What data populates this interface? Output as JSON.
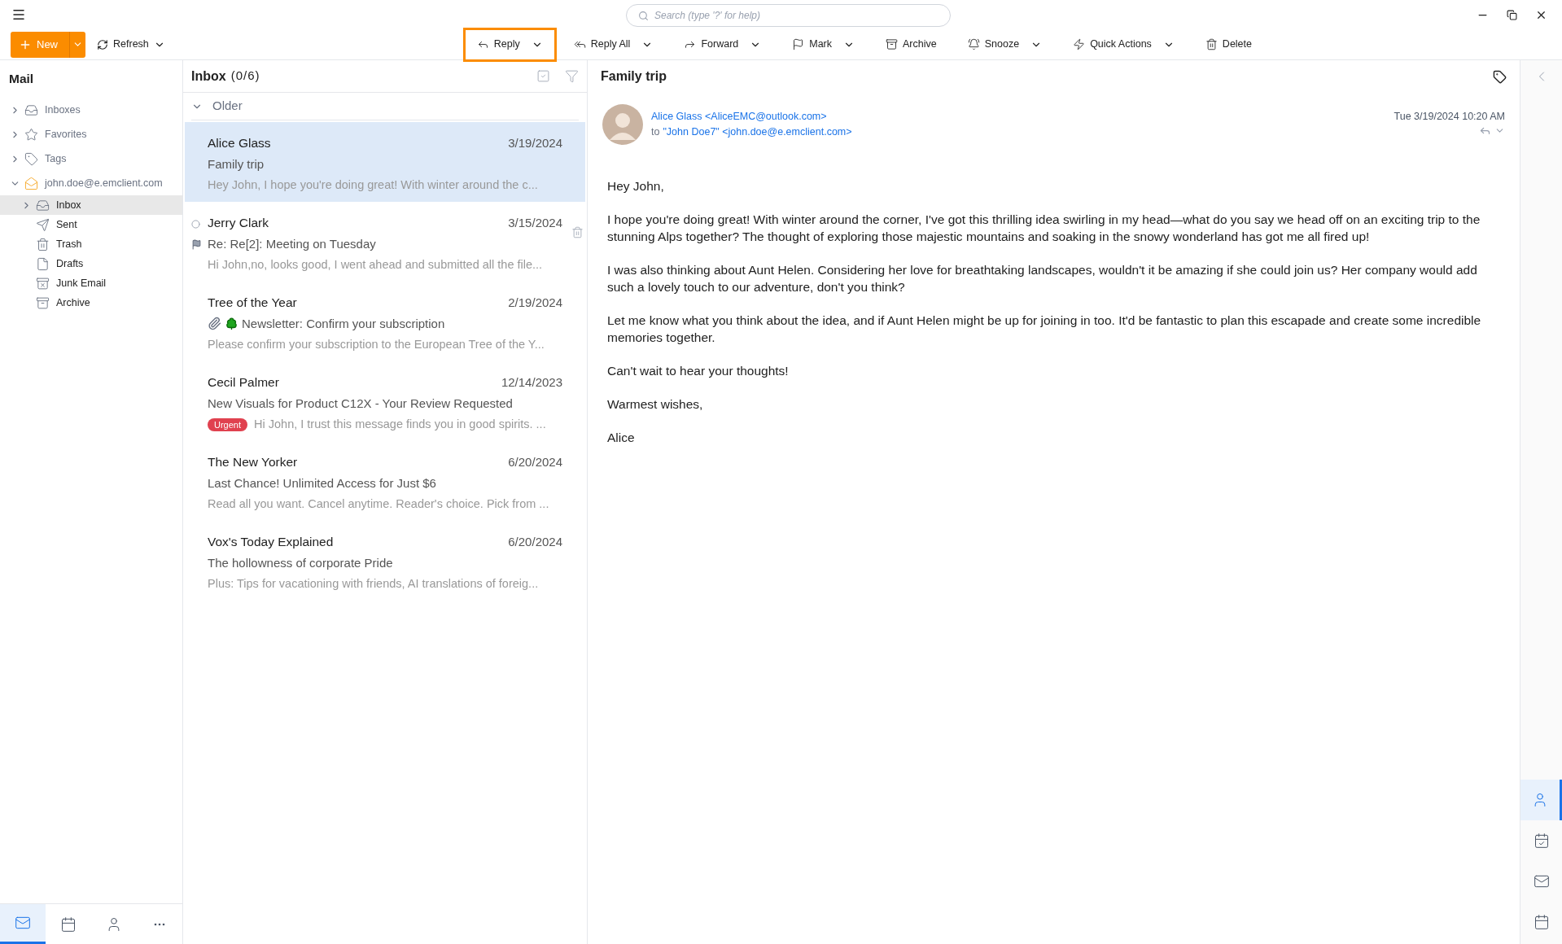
{
  "search": {
    "placeholder": "Search (type '?' for help)"
  },
  "new_button": {
    "label": "New"
  },
  "refresh_button": {
    "label": "Refresh"
  },
  "toolbar": [
    {
      "label": "Reply",
      "selected": true,
      "has_menu": true
    },
    {
      "label": "Reply All",
      "selected": false,
      "has_menu": true
    },
    {
      "label": "Forward",
      "selected": false,
      "has_menu": true
    },
    {
      "label": "Mark",
      "selected": false,
      "has_menu": true
    },
    {
      "label": "Archive",
      "selected": false,
      "has_menu": false
    },
    {
      "label": "Snooze",
      "selected": false,
      "has_menu": true
    },
    {
      "label": "Quick Actions",
      "selected": false,
      "has_menu": true
    },
    {
      "label": "Delete",
      "selected": false,
      "has_menu": false
    }
  ],
  "sidebar": {
    "title": "Mail",
    "items": [
      {
        "label": "Inboxes",
        "kind": "inboxes",
        "expanded": false,
        "selected": false
      },
      {
        "label": "Favorites",
        "kind": "favorites",
        "expanded": false,
        "selected": false
      },
      {
        "label": "Tags",
        "kind": "tags",
        "expanded": false,
        "selected": false
      },
      {
        "label": "john.doe@e.emclient.com",
        "kind": "account",
        "expanded": true,
        "selected": false,
        "children": [
          {
            "label": "Inbox",
            "kind": "inbox",
            "expanded": false,
            "selected": true
          },
          {
            "label": "Sent",
            "kind": "sent",
            "selected": false
          },
          {
            "label": "Trash",
            "kind": "trash",
            "selected": false
          },
          {
            "label": "Drafts",
            "kind": "drafts",
            "selected": false
          },
          {
            "label": "Junk Email",
            "kind": "junk",
            "selected": false
          },
          {
            "label": "Archive",
            "kind": "archive",
            "selected": false
          }
        ]
      }
    ]
  },
  "message_list": {
    "title": "Inbox",
    "count": "(0/6)",
    "group": {
      "label": "Older",
      "expanded": true
    },
    "messages": [
      {
        "sender": "Alice Glass",
        "date": "3/19/2024",
        "subject": "Family trip",
        "preview": "Hey John, I hope you're doing great! With winter around the c...",
        "selected": true,
        "hovered": false,
        "flagged": false
      },
      {
        "sender": "Jerry Clark",
        "date": "3/15/2024",
        "subject": "Re: Re[2]: Meeting on Tuesday",
        "preview": "Hi John,no, looks good, I went ahead and submitted all the file...",
        "selected": false,
        "hovered": true,
        "flagged": true
      },
      {
        "sender": "Tree of the Year",
        "date": "2/19/2024",
        "subject": "Newsletter: Confirm your subscription",
        "preview": "Please confirm your subscription to the European Tree of the Y...",
        "selected": false,
        "hovered": false,
        "flagged": false,
        "attachment": true,
        "tree_icon": true
      },
      {
        "sender": "Cecil Palmer",
        "date": "12/14/2023",
        "subject": "New Visuals for Product C12X - Your Review Requested",
        "preview": "Hi John, I trust this message finds you in good spirits. ...",
        "selected": false,
        "hovered": false,
        "flagged": false,
        "tag": {
          "label": "Urgent",
          "color": "#e0414f"
        }
      },
      {
        "sender": "The New Yorker",
        "date": "6/20/2024",
        "subject": "Last Chance! Unlimited Access for Just $6",
        "preview": "Read all you want. Cancel anytime. Reader's choice. Pick from ...",
        "selected": false,
        "hovered": false,
        "flagged": false
      },
      {
        "sender": "Vox's Today Explained",
        "date": "6/20/2024",
        "subject": "The hollowness of corporate Pride",
        "preview": "Plus: Tips for vacationing with friends, AI translations of foreig...",
        "selected": false,
        "hovered": false,
        "flagged": false
      }
    ]
  },
  "reading_pane": {
    "title": "Family trip",
    "from": "Alice Glass <AliceEMC@outlook.com>",
    "to_label": "to",
    "to": "\"John Doe7\" <john.doe@e.emclient.com>",
    "date": "Tue 3/19/2024 10:20 AM",
    "body": [
      "Hey John,",
      "I hope you're doing great! With winter around the corner, I've got this thrilling idea swirling in my head—what do you say we head off on an exciting trip to the stunning Alps together? The thought of exploring those majestic mountains and soaking in the snowy wonderland has got me all fired up!",
      "I was also thinking about Aunt Helen. Considering her love for breathtaking landscapes, wouldn't it be amazing if she could join us? Her company would add such a lovely touch to our adventure, don't you think?",
      "Let me know what you think about the idea, and if Aunt Helen might be up for joining in too. It'd be fantastic to plan this escapade and create some incredible memories together.",
      "Can't wait to hear your thoughts!",
      "Warmest wishes,",
      "Alice"
    ]
  },
  "bottom_nav": [
    {
      "kind": "mail",
      "selected": true
    },
    {
      "kind": "calendar",
      "selected": false
    },
    {
      "kind": "contacts",
      "selected": false
    },
    {
      "kind": "more",
      "selected": false
    }
  ],
  "right_rail": [
    {
      "kind": "contacts",
      "selected": true
    },
    {
      "kind": "tasks",
      "selected": false
    },
    {
      "kind": "mail",
      "selected": false
    },
    {
      "kind": "calendar",
      "selected": false
    }
  ]
}
